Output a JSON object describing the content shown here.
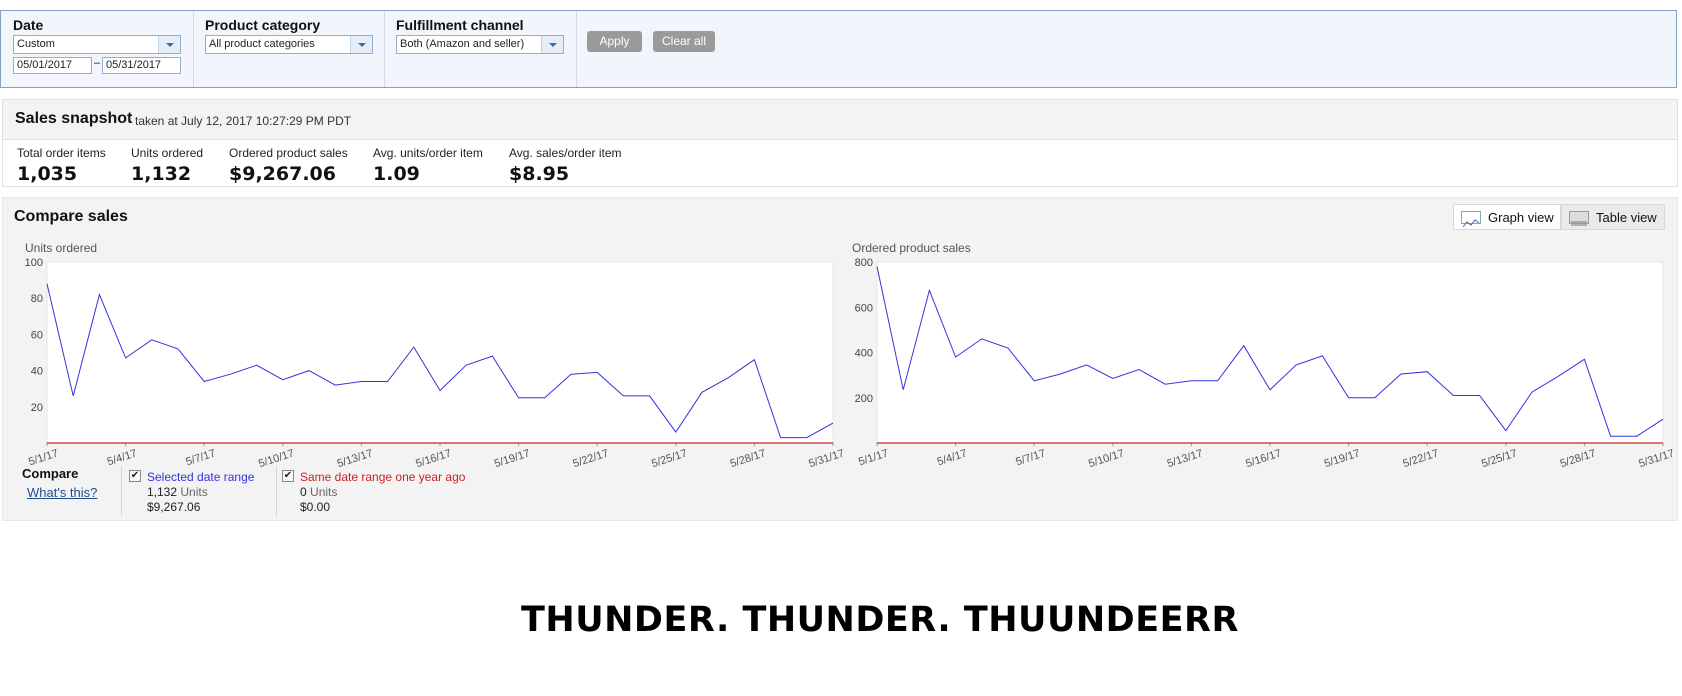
{
  "filters": {
    "date": {
      "label": "Date",
      "selected": "Custom",
      "start": "05/01/2017",
      "end": "05/31/2017",
      "separator": "–"
    },
    "category": {
      "label": "Product category",
      "selected": "All product categories"
    },
    "channel": {
      "label": "Fulfillment channel",
      "selected": "Both (Amazon and seller)"
    },
    "apply_label": "Apply",
    "clear_label": "Clear all"
  },
  "snapshot": {
    "title": "Sales snapshot",
    "subtitle": "taken at July 12, 2017 10:27:29 PM PDT",
    "metrics": [
      {
        "label": "Total order items",
        "value": "1,035"
      },
      {
        "label": "Units ordered",
        "value": "1,132"
      },
      {
        "label": "Ordered product sales",
        "value": "$9,267.06"
      },
      {
        "label": "Avg. units/order item",
        "value": "1.09"
      },
      {
        "label": "Avg. sales/order item",
        "value": "$8.95"
      }
    ]
  },
  "compare": {
    "title": "Compare sales",
    "graph_view_label": "Graph view",
    "table_view_label": "Table view",
    "legend": {
      "title": "Compare",
      "link": "What's this?",
      "current": {
        "label": "Selected date range",
        "units": "1,132",
        "units_label": "Units",
        "sales": "$9,267.06"
      },
      "previous": {
        "label": "Same date range one year ago",
        "units": "0",
        "units_label": "Units",
        "sales": "$0.00"
      }
    },
    "colors": {
      "current": "#3333dd",
      "previous": "#cc2222"
    }
  },
  "chart_data": [
    {
      "type": "line",
      "ylabel": "Units ordered",
      "ylim": [
        0,
        100
      ],
      "yticks": [
        20,
        40,
        60,
        80,
        100
      ],
      "xticks": [
        "5/1/17",
        "5/4/17",
        "5/7/17",
        "5/10/17",
        "5/13/17",
        "5/16/17",
        "5/19/17",
        "5/22/17",
        "5/25/17",
        "5/28/17",
        "5/31/17"
      ],
      "series": [
        {
          "name": "Selected date range",
          "values": [
            88,
            26,
            82,
            47,
            57,
            52,
            34,
            38,
            43,
            35,
            40,
            32,
            34,
            34,
            53,
            29,
            43,
            48,
            25,
            25,
            38,
            39,
            26,
            26,
            6,
            28,
            36,
            46,
            3,
            3,
            11
          ]
        },
        {
          "name": "Same date range one year ago",
          "values": [
            0,
            0,
            0,
            0,
            0,
            0,
            0,
            0,
            0,
            0,
            0,
            0,
            0,
            0,
            0,
            0,
            0,
            0,
            0,
            0,
            0,
            0,
            0,
            0,
            0,
            0,
            0,
            0,
            0,
            0,
            0
          ]
        }
      ]
    },
    {
      "type": "line",
      "ylabel": "Ordered product sales",
      "ylim": [
        0,
        800
      ],
      "yticks": [
        200,
        400,
        600,
        800
      ],
      "xticks": [
        "5/1/17",
        "5/4/17",
        "5/7/17",
        "5/10/17",
        "5/13/17",
        "5/16/17",
        "5/19/17",
        "5/22/17",
        "5/25/17",
        "5/28/17",
        "5/31/17"
      ],
      "series": [
        {
          "name": "Selected date range",
          "values": [
            780,
            235,
            675,
            380,
            460,
            420,
            275,
            305,
            345,
            285,
            325,
            260,
            275,
            275,
            430,
            235,
            345,
            385,
            200,
            200,
            305,
            315,
            210,
            210,
            55,
            225,
            295,
            370,
            30,
            30,
            105
          ]
        },
        {
          "name": "Same date range one year ago",
          "values": [
            0,
            0,
            0,
            0,
            0,
            0,
            0,
            0,
            0,
            0,
            0,
            0,
            0,
            0,
            0,
            0,
            0,
            0,
            0,
            0,
            0,
            0,
            0,
            0,
            0,
            0,
            0,
            0,
            0,
            0,
            0
          ]
        }
      ]
    }
  ],
  "caption": "THUNDER. THUNDER. THUUNDEERR"
}
